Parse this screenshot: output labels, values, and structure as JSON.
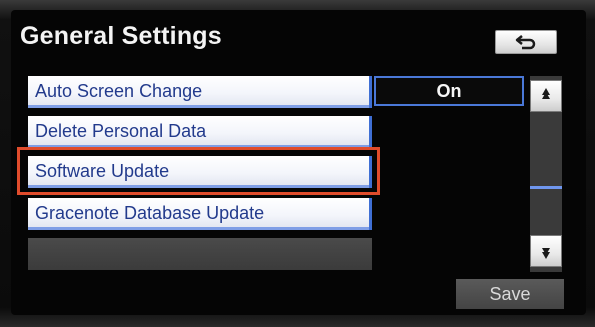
{
  "screen": {
    "title": "General Settings"
  },
  "header": {
    "back_icon": "return-arrow-icon"
  },
  "list": {
    "items": [
      {
        "label": "Auto Screen Change",
        "value": "On"
      },
      {
        "label": "Delete Personal Data"
      },
      {
        "label": "Software Update",
        "highlighted": true
      },
      {
        "label": "Gracenote Database Update"
      },
      {
        "label": ""
      }
    ]
  },
  "scroll": {
    "up_icon": "scroll-up-icon",
    "down_icon": "scroll-down-icon"
  },
  "footer": {
    "save_label": "Save"
  },
  "colors": {
    "accent_blue": "#3f6fd4",
    "highlight_red": "#e04c2c",
    "item_text": "#223a8c"
  }
}
